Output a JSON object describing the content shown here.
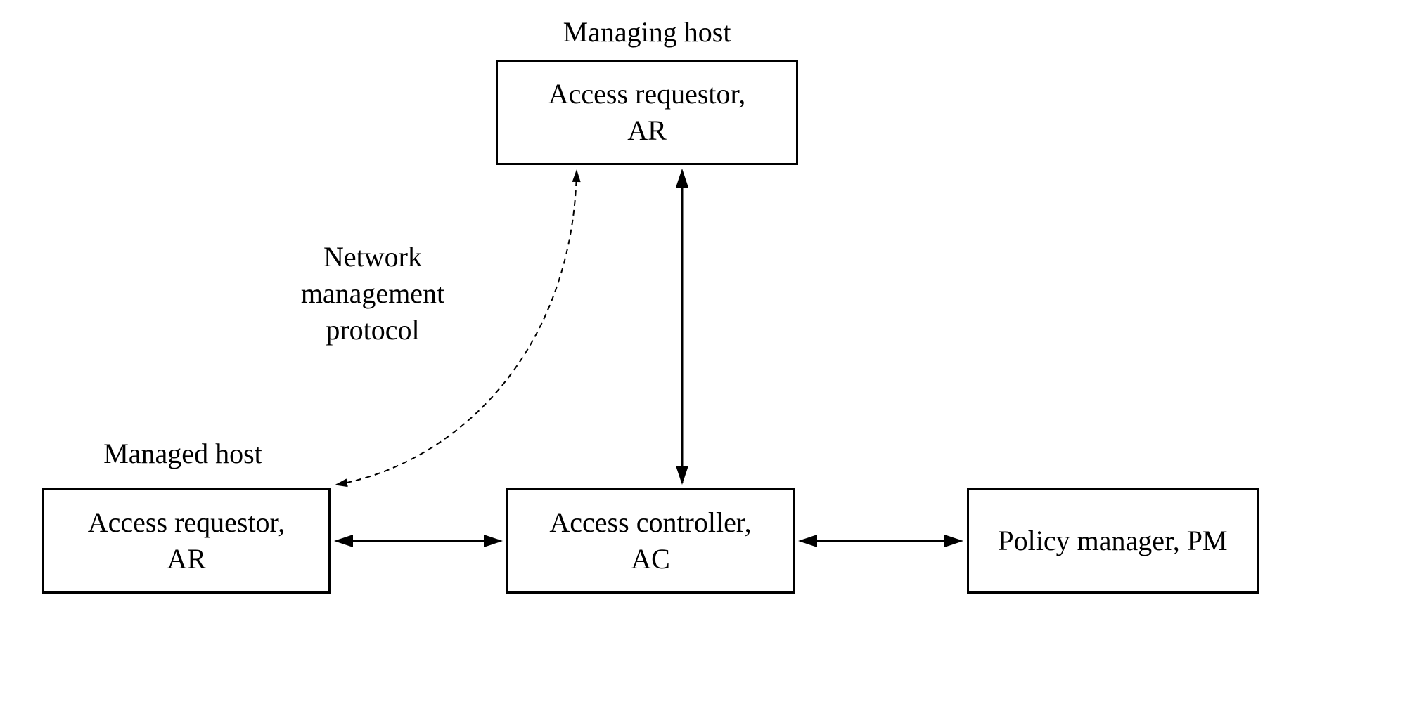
{
  "labels": {
    "managing_host": "Managing host",
    "managed_host": "Managed host",
    "network_protocol_line1": "Network",
    "network_protocol_line2": "management",
    "network_protocol_line3": "protocol"
  },
  "boxes": {
    "ar_top_line1": "Access requestor,",
    "ar_top_line2": "AR",
    "ar_bottom_line1": "Access requestor,",
    "ar_bottom_line2": "AR",
    "ac_line1": "Access controller,",
    "ac_line2": "AC",
    "pm": "Policy manager, PM"
  }
}
